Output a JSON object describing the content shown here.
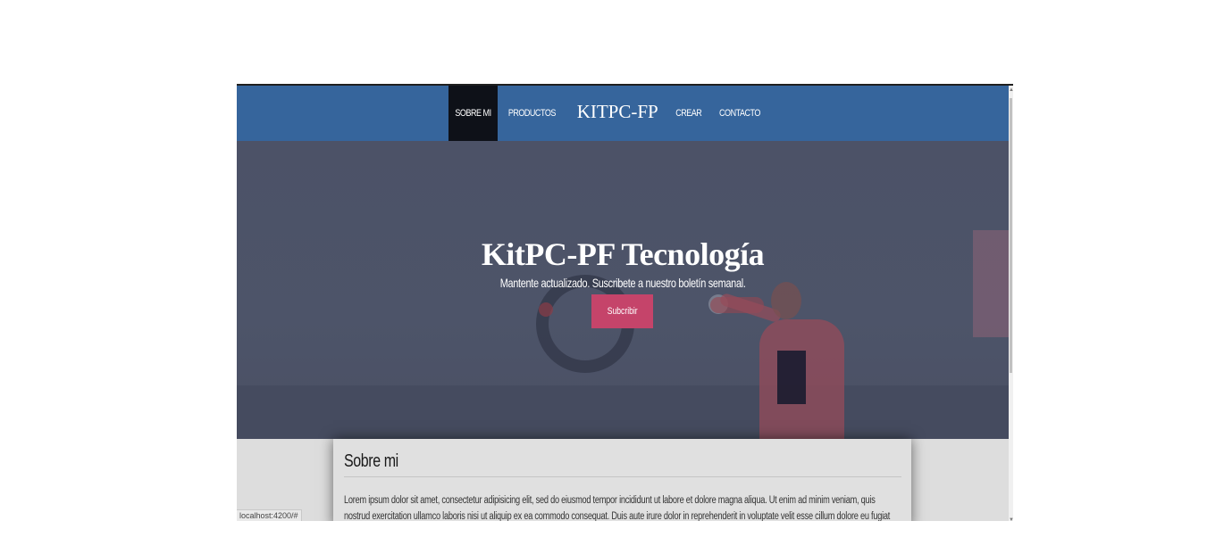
{
  "navbar": {
    "items": [
      {
        "label": "SOBRE MI",
        "active": true
      },
      {
        "label": "PRODUCTOS",
        "active": false
      }
    ],
    "brand": "KITPC-FP",
    "items_right": [
      {
        "label": "CREAR",
        "active": false
      },
      {
        "label": "CONTACTO",
        "active": false
      }
    ]
  },
  "hero": {
    "title": "KitPC-PF Tecnología",
    "subtitle": "Mantente actualizado. Suscribete a nuestro boletín semanal.",
    "button_label": "Subcribir",
    "button_color": "#c5446a"
  },
  "section": {
    "title": "Sobre mi",
    "text": "Lorem ipsum dolor sit amet, consectetur adipisicing elit, sed do eiusmod tempor incididunt ut labore et dolore magna aliqua. Ut enim ad minim veniam, quis nostrud exercitation ullamco laboris nisi ut aliquip ex ea commodo consequat. Duis aute irure dolor in reprehenderit in voluptate velit esse cillum dolore eu fugiat nulla pariatur."
  },
  "status_bar": {
    "url": "localhost:4200/#"
  },
  "colors": {
    "navbar": "#36659c",
    "nav_active": "#0e1118",
    "hero_overlay": "#4a5068"
  }
}
